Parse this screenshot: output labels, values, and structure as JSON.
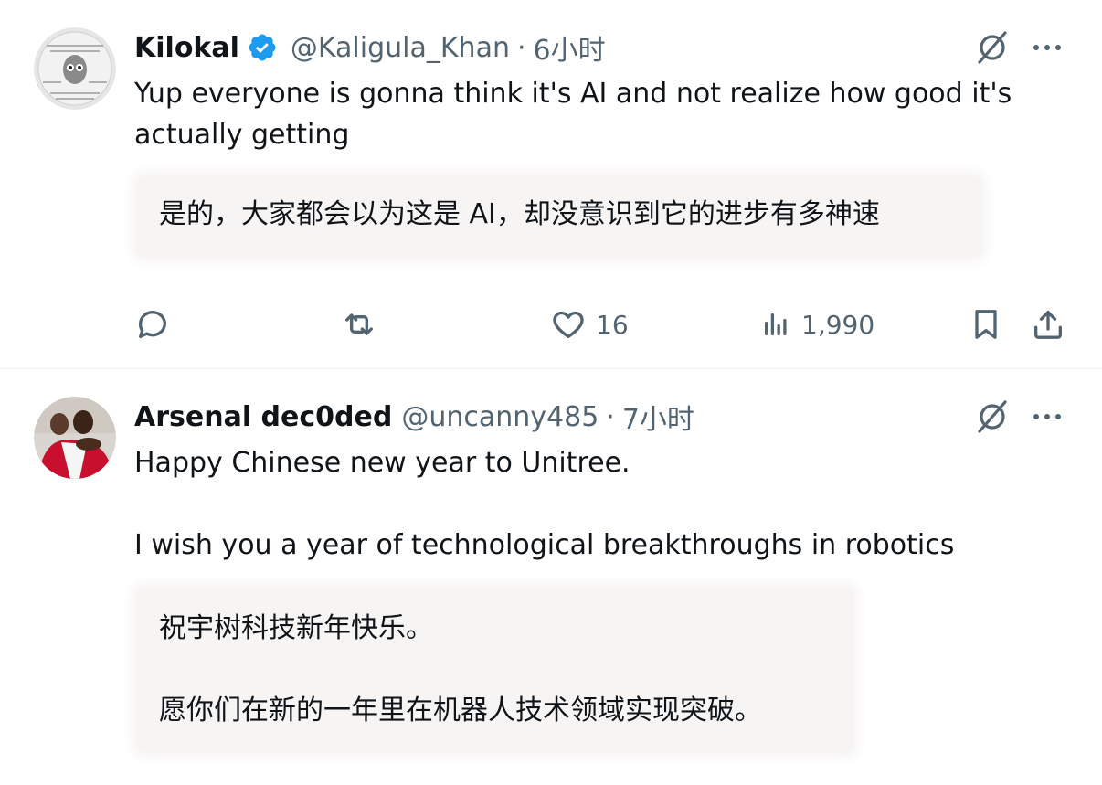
{
  "tweets": [
    {
      "display_name": "Kilokal",
      "verified_icon": "verified-badge-icon",
      "handle": "@Kaligula_Khan",
      "separator": "·",
      "time": "6小时",
      "text": "Yup everyone is gonna think it's AI and not realize how good it's\nactually getting",
      "translation": "是的，大家都会以为这是 AI，却没意识到它的进步有多神速",
      "actions": {
        "reply_count": "",
        "retweet_count": "",
        "like_count": "16",
        "view_count": "1,990"
      }
    },
    {
      "display_name": "Arsenal dec0ded",
      "handle": "@uncanny485",
      "separator": "·",
      "time": "7小时",
      "text": "Happy Chinese new year to Unitree.\n\nI wish you a year of technological breakthroughs in robotics",
      "translation": "祝宇树科技新年快乐。\n\n愿你们在新的一年里在机器人技术领域实现突破。"
    }
  ],
  "colors": {
    "text_primary": "#0f1419",
    "text_secondary": "#536471",
    "verified_blue": "#1d9bf0",
    "translation_bg": "#f7f5f4"
  }
}
